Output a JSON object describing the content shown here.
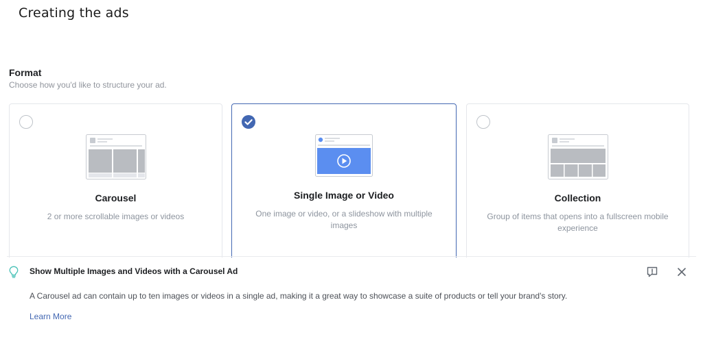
{
  "page": {
    "heading": "Creating the ads"
  },
  "format": {
    "title": "Format",
    "subtitle": "Choose how you'd like to structure your ad.",
    "options": [
      {
        "title": "Carousel",
        "description": "2 or more scrollable images or videos",
        "selected": false,
        "icon": "carousel-layout-icon"
      },
      {
        "title": "Single Image or Video",
        "description": "One image or video, or a slideshow with multiple images",
        "selected": true,
        "icon": "single-video-layout-icon"
      },
      {
        "title": "Collection",
        "description": "Group of items that opens into a fullscreen mobile experience",
        "selected": false,
        "icon": "collection-layout-icon"
      }
    ]
  },
  "tip": {
    "title": "Show Multiple Images and Videos with a Carousel Ad",
    "body": "A Carousel ad can contain up to ten images or videos in a single ad, making it a great way to showcase a suite of products or tell your brand's story.",
    "link": "Learn More",
    "icons": [
      "lightbulb-icon",
      "feedback-icon",
      "close-icon"
    ]
  },
  "colors": {
    "accent": "#4267b2",
    "thumb_blue": "#5b8ef0",
    "border": "#e4e6eb",
    "muted_text": "#8d949e"
  }
}
